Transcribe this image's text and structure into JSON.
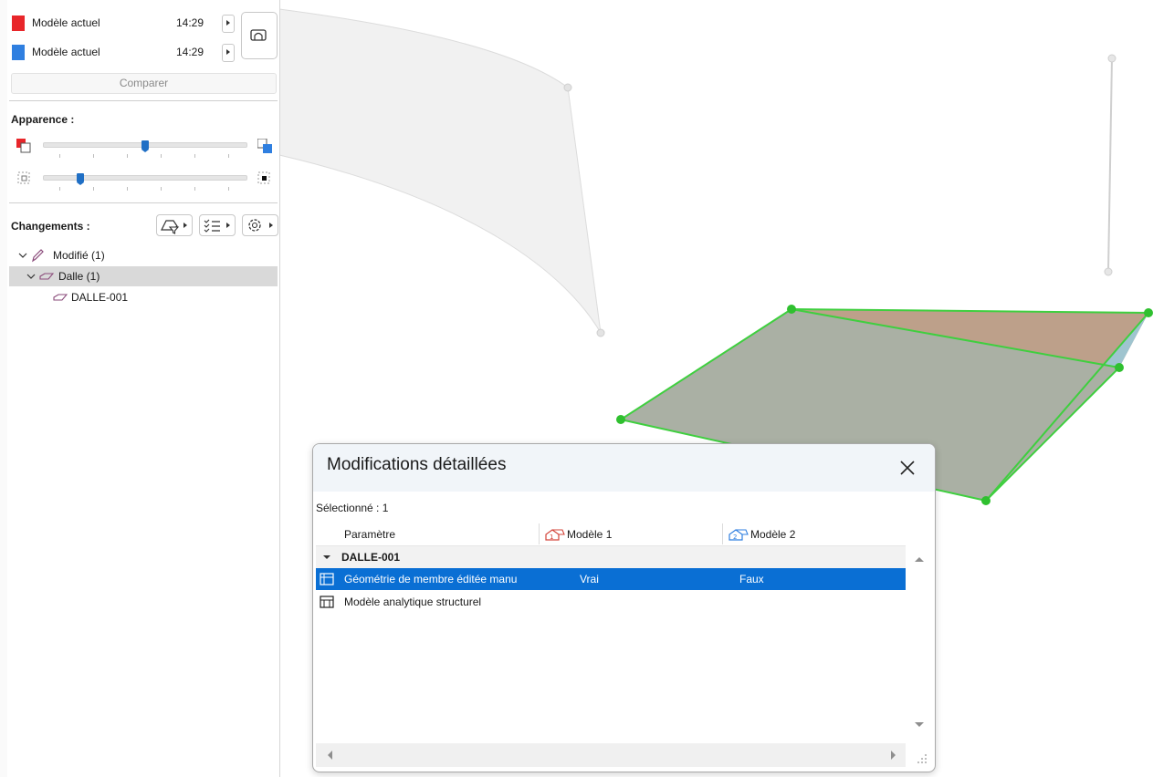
{
  "panel": {
    "models": [
      {
        "name": "Modèle actuel",
        "time": "14:29",
        "color": "#e8262a"
      },
      {
        "name": "Modèle actuel",
        "time": "14:29",
        "color": "#2f7fe0"
      }
    ],
    "compare_label": "Comparer",
    "appearance_label": "Apparence :",
    "changes_label": "Changements :",
    "sliders": {
      "color_blend": 0.5,
      "transparency": 0.18
    },
    "tree": [
      {
        "label": "Modifié (1)"
      },
      {
        "label": "Dalle (1)"
      },
      {
        "label": "DALLE-001"
      }
    ]
  },
  "dialog": {
    "title": "Modifications détaillées",
    "selected": "Sélectionné : 1",
    "columns": {
      "param": "Paramètre",
      "model1": "Modèle 1",
      "model2": "Modèle 2"
    },
    "group": "DALLE-001",
    "rows": [
      {
        "param": "Géométrie de membre éditée manu",
        "model1": "Vrai",
        "model2": "Faux"
      },
      {
        "param": "Modèle analytique structurel",
        "model1": "",
        "model2": ""
      }
    ]
  }
}
